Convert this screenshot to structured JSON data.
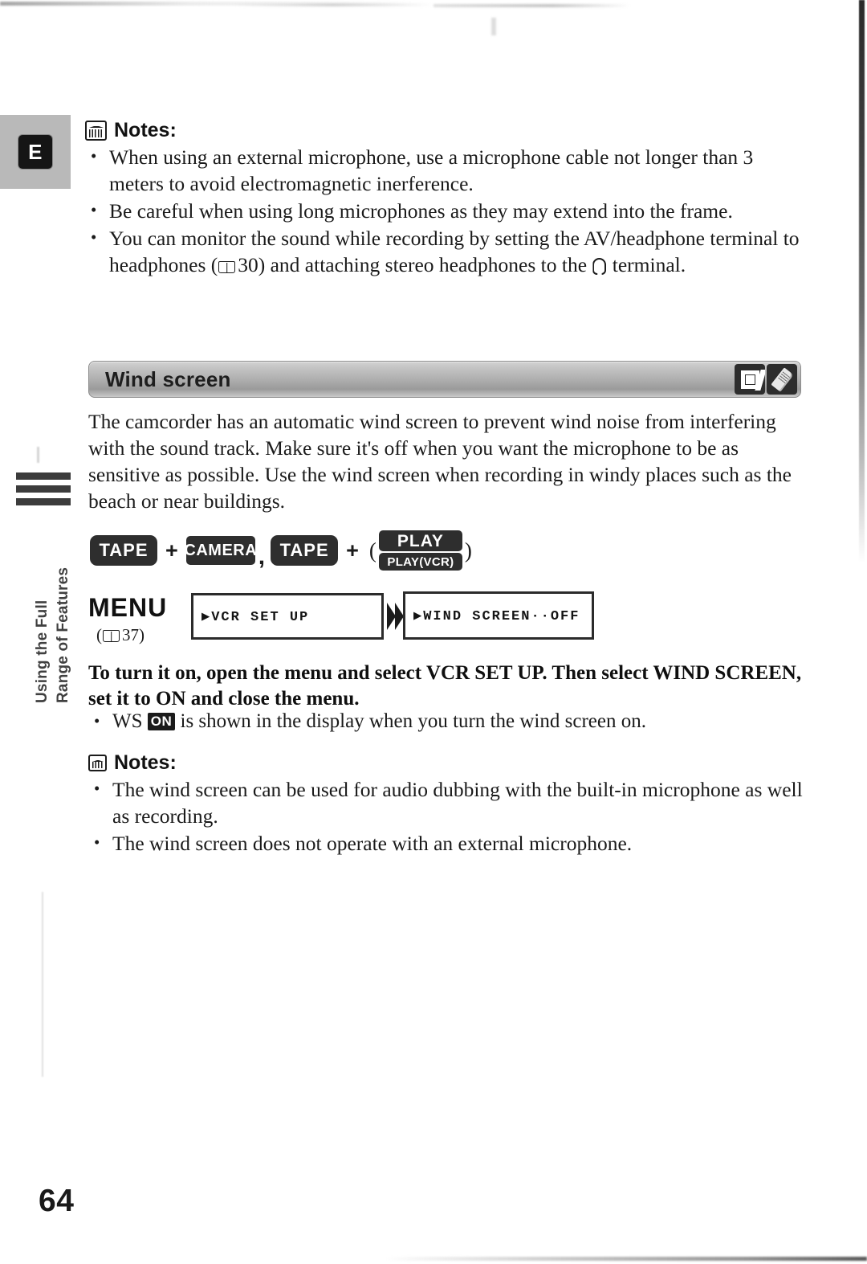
{
  "page": {
    "number": "64",
    "language_tab": "E"
  },
  "chapter_tab": {
    "line1": "Using the Full",
    "line2": "Range of Features"
  },
  "notes_top": {
    "heading": "Notes:",
    "icon": "book-icon",
    "items": [
      {
        "text_before": "When using an external microphone, use a microphone cable not longer than 3 meters to avoid electromagnetic inerference."
      },
      {
        "text_before": "Be careful when using long microphones as they may extend into the frame."
      },
      {
        "text_before": "You can monitor the sound while recording by setting the AV/headphone terminal to headphones (",
        "ref_page": "30",
        "text_mid": ") and attaching stereo headphones to the ",
        "text_after": " terminal."
      }
    ]
  },
  "section": {
    "title": "Wind screen",
    "icons": [
      "tape-icon",
      "memory-card-icon"
    ]
  },
  "body": {
    "paragraph": "The camcorder has an automatic wind screen to prevent wind noise from interfering with the sound track. Make sure it's off when you want the microphone to be as sensitive as possible. Use the wind screen when recording in windy places such as the beach or near buildings."
  },
  "mode_row": {
    "tape_1": "TAPE",
    "plus_1": "+",
    "camera": "CAMERA",
    "comma": ",",
    "tape_2": "TAPE",
    "plus_2": "+",
    "paren_open": "(",
    "play": "PLAY",
    "play_vcr": "PLAY(VCR)",
    "paren_close": ")"
  },
  "menu_flow": {
    "menu_label": "MENU",
    "menu_ref_page": "37",
    "arrow": "double-chevron-right-icon",
    "screen_1": "▶VCR SET UP",
    "screen_2": "▶WIND SCREEN··OFF"
  },
  "instruction": {
    "bold_text": "To turn it on, open the menu and select VCR SET UP. Then select WIND SCREEN, set it to ON and close the menu.",
    "bullet_before": "WS ",
    "bullet_badge": "ON",
    "bullet_after": " is shown in the display when you turn the wind screen on."
  },
  "notes_bottom": {
    "heading": "Notes:",
    "icon": "book-icon",
    "items": [
      "The wind screen can be used for audio dubbing with the built-in microphone as well as recording.",
      "The wind screen does not operate with an external microphone."
    ]
  }
}
